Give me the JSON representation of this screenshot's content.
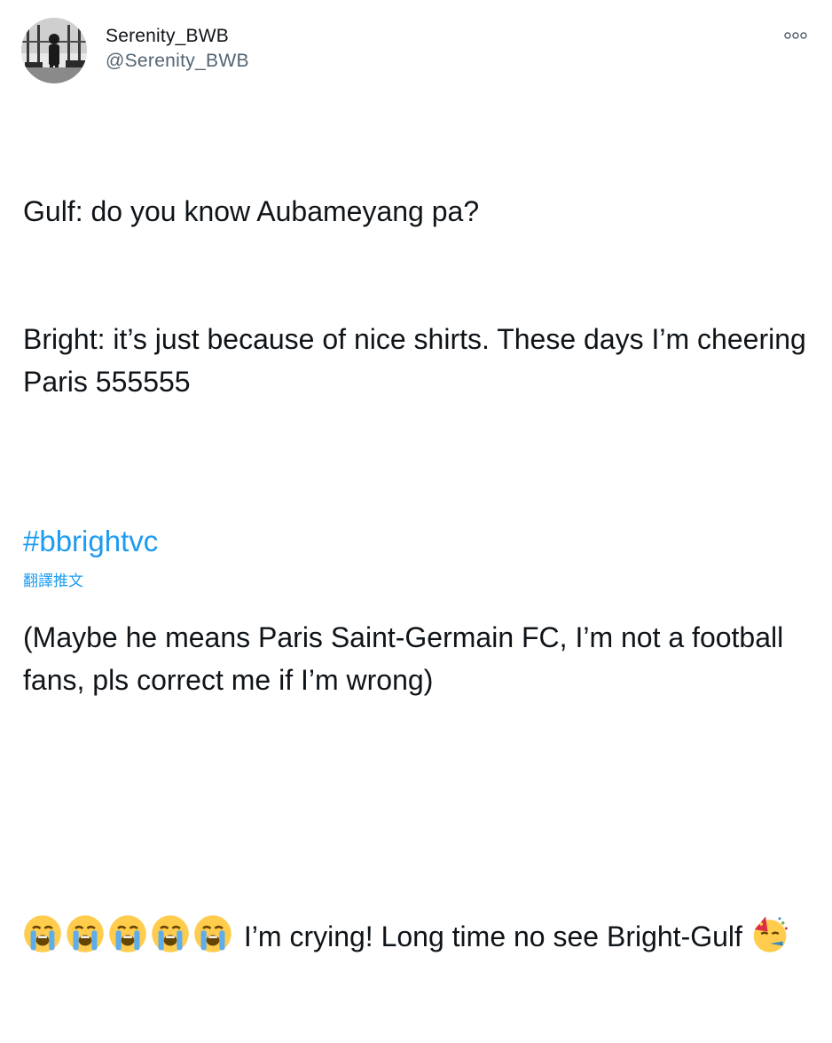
{
  "user": {
    "display_name": "Serenity_BWB",
    "handle": "@Serenity_BWB",
    "avatar_icon": "avatar-photo"
  },
  "menu": {
    "icon": "more-dots-icon"
  },
  "tweet": {
    "line1": "Gulf: do you know Aubameyang pa?",
    "line2": "Bright: it’s just because of nice shirts. These days I’m cheering Paris 555555",
    "line3": "(Maybe he means Paris Saint-Germain FC, I’m not a football fans, pls correct me if I’m wrong)",
    "line4_text": " I’m crying! Long time no see Bright-Gulf ",
    "emojis": [
      "loudly-crying-face",
      "loudly-crying-face",
      "loudly-crying-face",
      "loudly-crying-face",
      "loudly-crying-face",
      "partying-face"
    ],
    "hashtag": "#bbrightvc",
    "translate_label": "翻譯推文"
  },
  "colors": {
    "link": "#1d9bf0",
    "text": "#0f1419",
    "secondary": "#536471"
  }
}
